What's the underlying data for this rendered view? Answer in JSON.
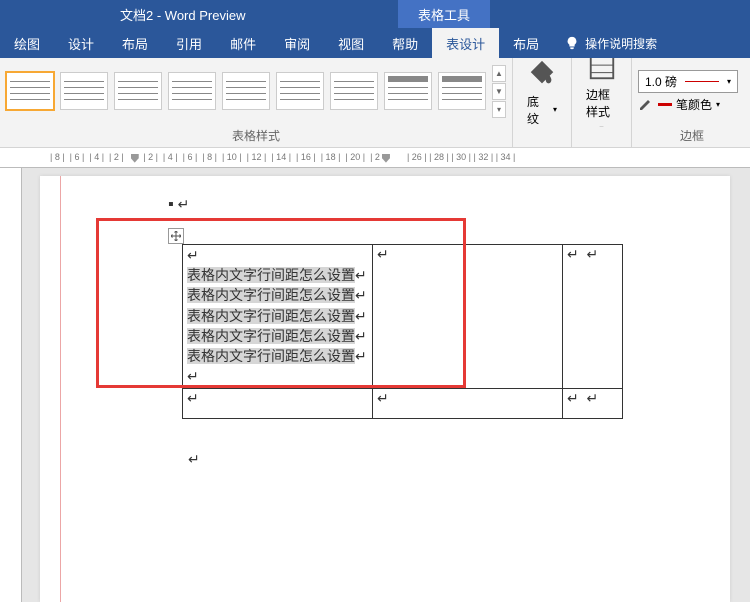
{
  "title": "文档2 - Word Preview",
  "contextual_tab": "表格工具",
  "tabs": [
    "绘图",
    "设计",
    "布局",
    "引用",
    "邮件",
    "审阅",
    "视图",
    "帮助",
    "表设计",
    "布局"
  ],
  "active_tab_index": 8,
  "tell_me": "操作说明搜索",
  "ribbon": {
    "styles_label": "表格样式",
    "shading_label": "底纹",
    "border_style_label": "边框样式",
    "border_group_label": "边框",
    "weight": "1.0 磅",
    "pen_color_label": "笔颜色"
  },
  "ruler_numbers": [
    "8",
    "6",
    "4",
    "2",
    "2",
    "4",
    "6",
    "8",
    "10",
    "12",
    "14",
    "16",
    "18",
    "20",
    "22",
    "26",
    "28",
    "30",
    "32",
    "34"
  ],
  "table_content": {
    "lines": [
      "表格内文字行间距怎么设置",
      "表格内文字行间距怎么设置",
      "表格内文字行间距怎么设置",
      "表格内文字行间距怎么设置",
      "表格内文字行间距怎么设置"
    ]
  },
  "enter_glyph": "↩",
  "para_glyph": "⏎"
}
